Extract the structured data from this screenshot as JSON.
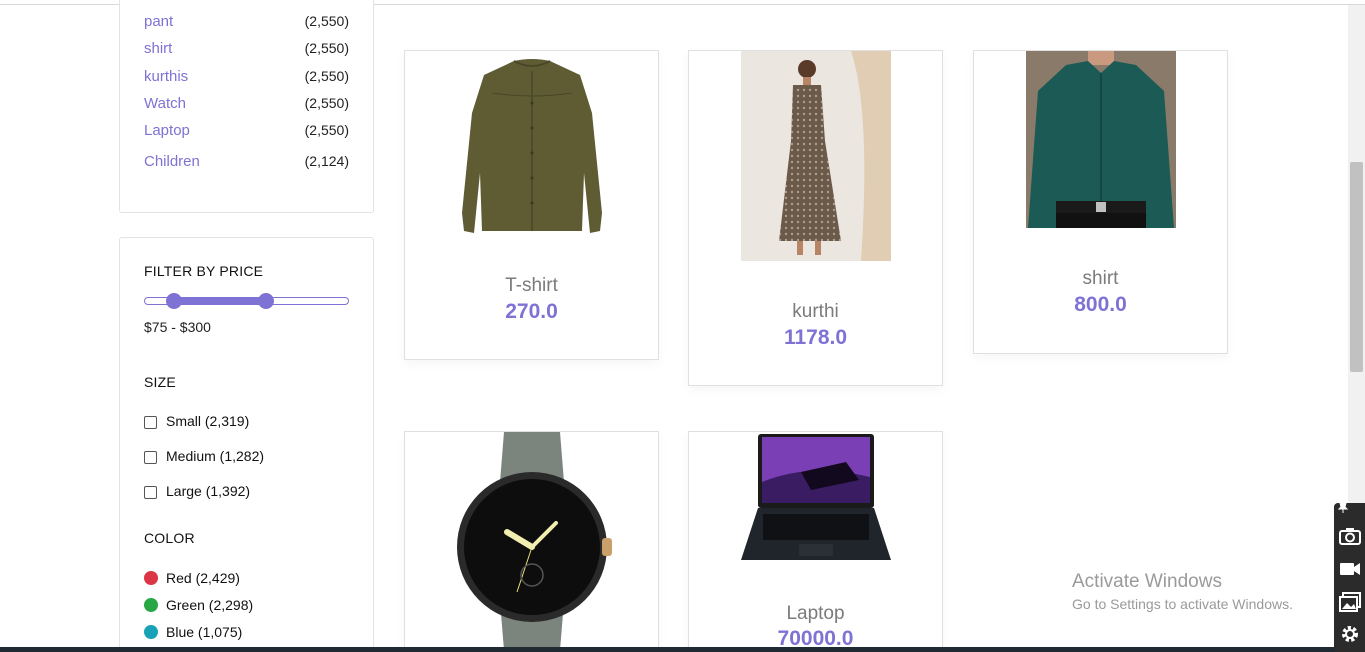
{
  "categories": [
    {
      "label": "pant",
      "count": "(2,550)"
    },
    {
      "label": "shirt",
      "count": "(2,550)"
    },
    {
      "label": "kurthis",
      "count": "(2,550)"
    },
    {
      "label": "Watch",
      "count": "(2,550)"
    },
    {
      "label": "Laptop",
      "count": "(2,550)"
    },
    {
      "label": "Children",
      "count": "(2,124)"
    }
  ],
  "price_filter": {
    "title": "FILTER BY PRICE",
    "range_text": "$75 - $300",
    "min_fraction": 0.14,
    "max_fraction": 0.59
  },
  "size_filter": {
    "title": "SIZE",
    "options": [
      {
        "label": "Small (2,319)",
        "checked": false
      },
      {
        "label": "Medium (1,282)",
        "checked": false
      },
      {
        "label": "Large (1,392)",
        "checked": false
      }
    ]
  },
  "color_filter": {
    "title": "COLOR",
    "options": [
      {
        "label": "Red (2,429)",
        "color": "#dc3545"
      },
      {
        "label": "Green (2,298)",
        "color": "#28a745"
      },
      {
        "label": "Blue (1,075)",
        "color": "#17a2b8"
      }
    ]
  },
  "products": [
    {
      "name": "T-shirt",
      "price": "270.0",
      "image": "olive-blouse"
    },
    {
      "name": "kurthi",
      "price": "1178.0",
      "image": "printed-kurthi-dress"
    },
    {
      "name": "shirt",
      "price": "800.0",
      "image": "teal-dress-shirt"
    },
    {
      "name": "",
      "price": "",
      "image": "smartwatch"
    },
    {
      "name": "Laptop",
      "price": "70000.0",
      "image": "gaming-laptop"
    }
  ],
  "activate_windows": {
    "line1": "Activate Windows",
    "line2": "Go to Settings to activate Windows."
  },
  "toolbar_icons": [
    "pin-icon",
    "camera-icon",
    "video-icon",
    "gallery-icon",
    "settings-icon"
  ],
  "colors": {
    "accent": "#7e72d4"
  }
}
